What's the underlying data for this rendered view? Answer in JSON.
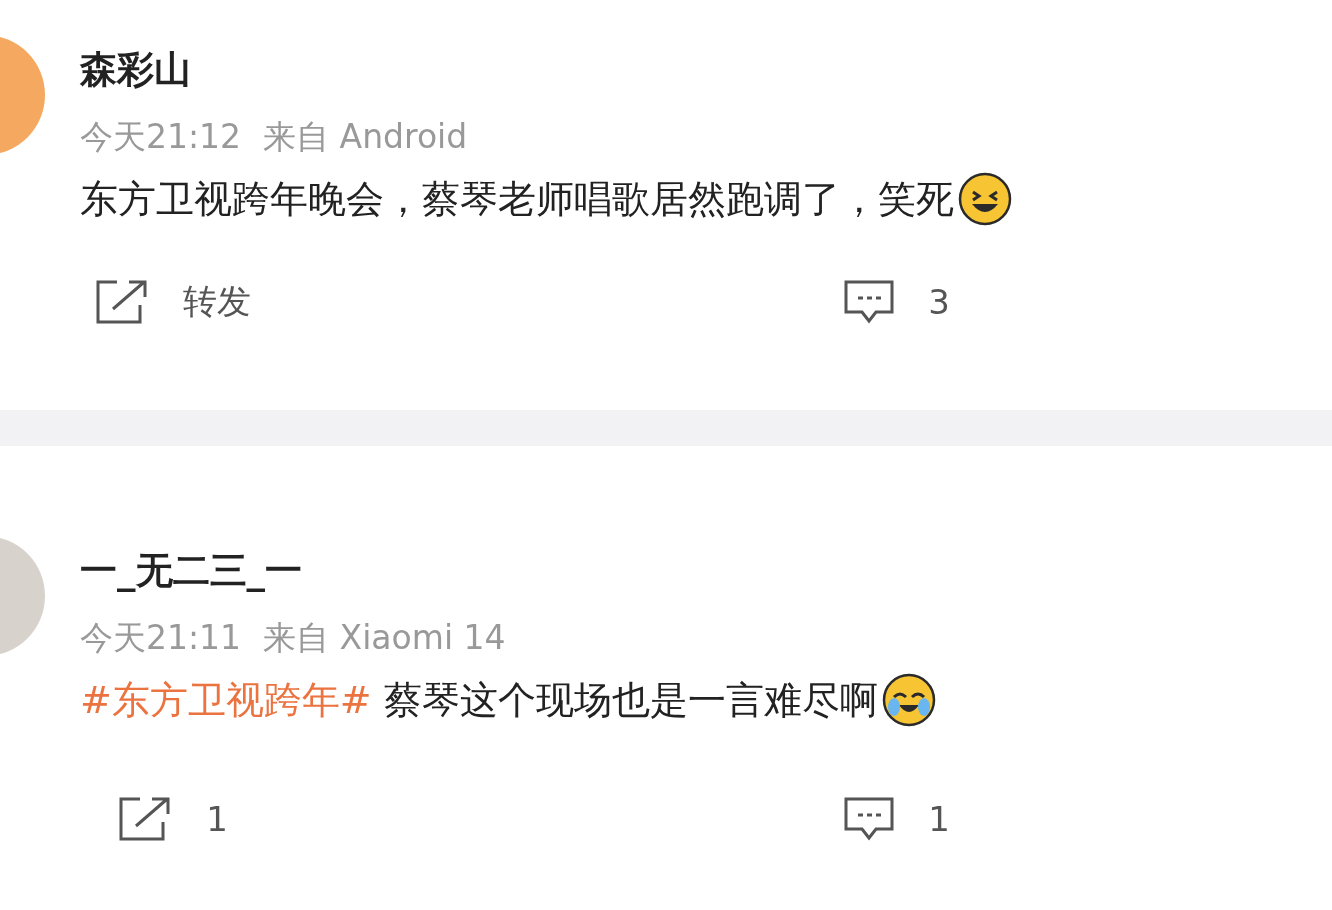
{
  "posts": [
    {
      "author": "森彩山",
      "time": "今天21:12",
      "source": "来自 Android",
      "content": [
        {
          "kind": "text",
          "text": "东方卫视跨年晚会，蔡琴老师唱歌居然跑调了，笑死"
        }
      ],
      "emoji": {
        "kind": "laugh"
      },
      "actions": [
        {
          "kind": "repost",
          "label": "转发"
        },
        {
          "kind": "comment",
          "label": "3"
        }
      ]
    },
    {
      "author": "一_无二三_一",
      "time": "今天21:11",
      "source": "来自 Xiaomi 14",
      "content": [
        {
          "kind": "hashtag",
          "text": "#东方卫视跨年#"
        },
        {
          "kind": "text",
          "text": " 蔡琴这个现场也是一言难尽啊"
        }
      ],
      "emoji": {
        "kind": "cry"
      },
      "actions": [
        {
          "kind": "repost",
          "label": "1"
        },
        {
          "kind": "comment",
          "label": "1"
        }
      ]
    }
  ]
}
